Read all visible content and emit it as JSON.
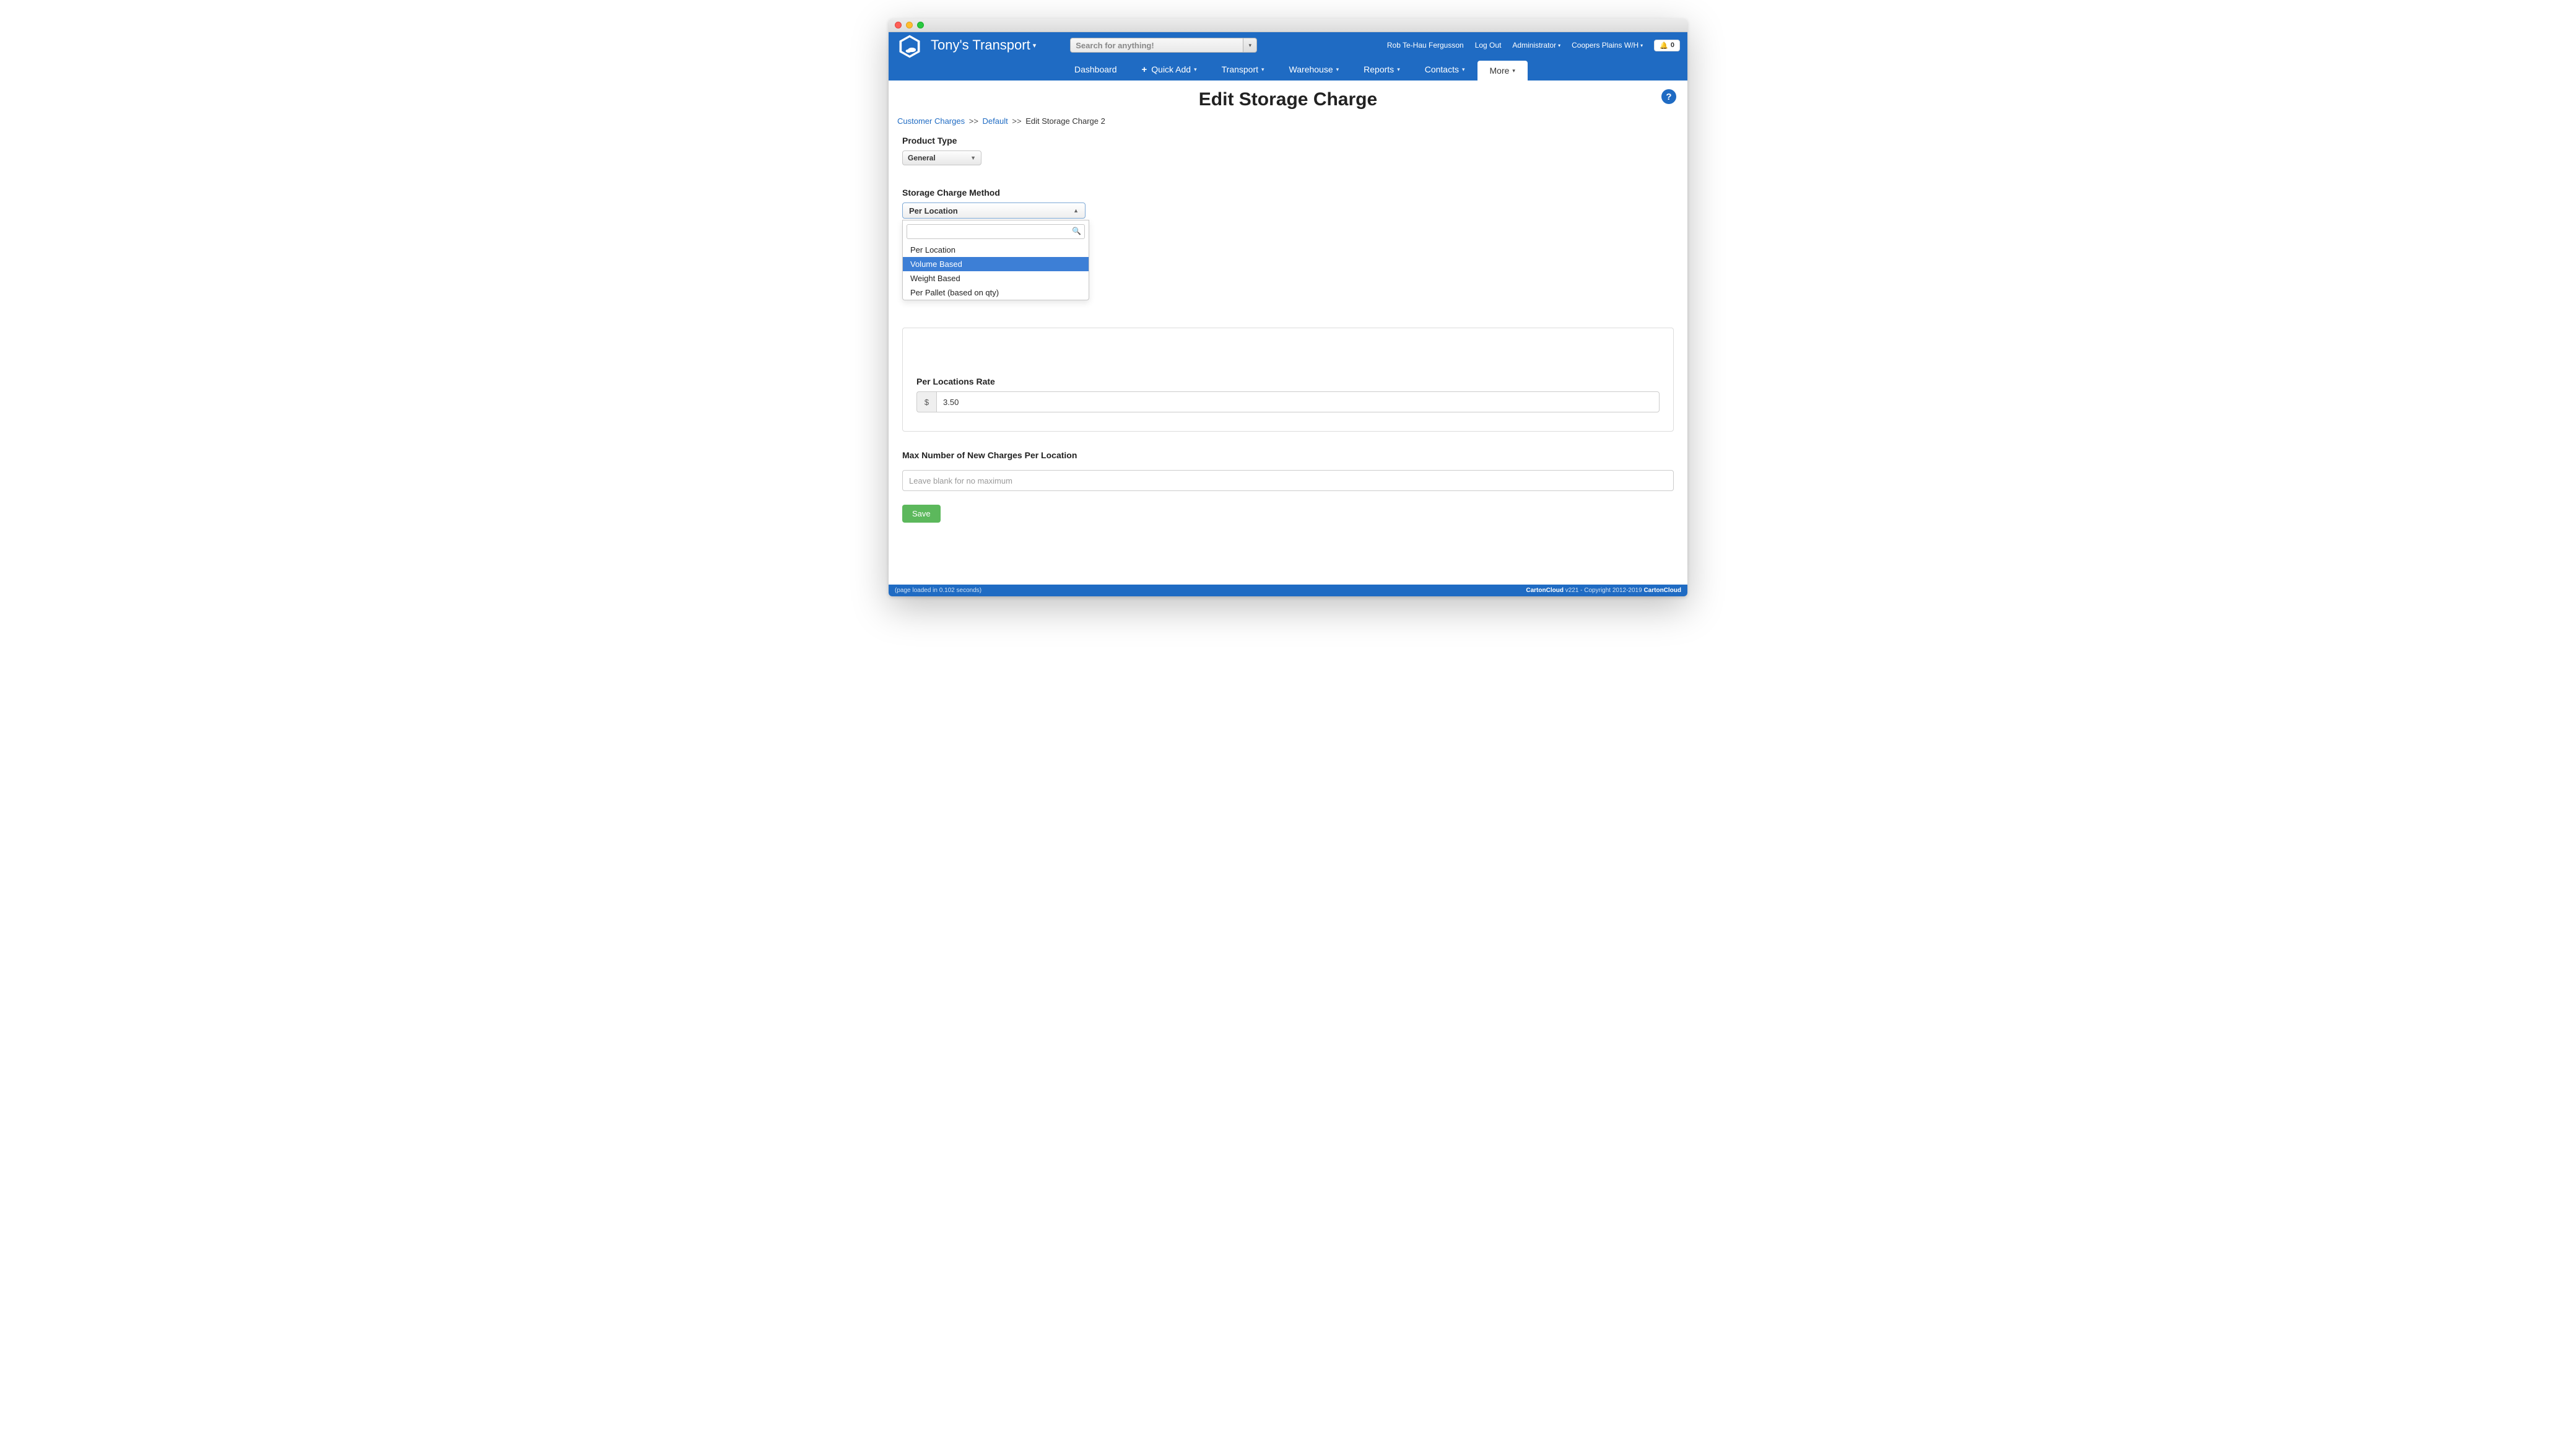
{
  "header": {
    "brand": "Tony's Transport",
    "search_placeholder": "Search for anything!",
    "user": "Rob Te-Hau Fergusson",
    "logout": "Log Out",
    "role": "Administrator",
    "location": "Coopers Plains W/H",
    "notif_count": "0"
  },
  "nav": {
    "items": [
      "Dashboard",
      "Quick Add",
      "Transport",
      "Warehouse",
      "Reports",
      "Contacts",
      "More"
    ],
    "active_index": 6
  },
  "page": {
    "title": "Edit Storage Charge",
    "breadcrumb": {
      "link1": "Customer Charges",
      "link2": "Default",
      "current": "Edit Storage Charge 2",
      "sep": ">>"
    }
  },
  "form": {
    "product_type_label": "Product Type",
    "product_type_value": "General",
    "method_label": "Storage Charge Method",
    "method_value": "Per Location",
    "method_search_value": "",
    "method_options": [
      "Per Location",
      "Volume Based",
      "Weight Based",
      "Per Pallet (based on qty)"
    ],
    "method_highlight_index": 1,
    "rate_label": "Per Locations Rate",
    "rate_currency": "$",
    "rate_value": "3.50",
    "max_label": "Max Number of New Charges Per Location",
    "max_placeholder": "Leave blank for no maximum",
    "max_value": "",
    "save": "Save"
  },
  "footer": {
    "left": "(page loaded in 0.102 seconds)",
    "brand": "CartonCloud",
    "version": " v221 - Copyright 2012-2019 ",
    "brand2": "CartonCloud"
  }
}
